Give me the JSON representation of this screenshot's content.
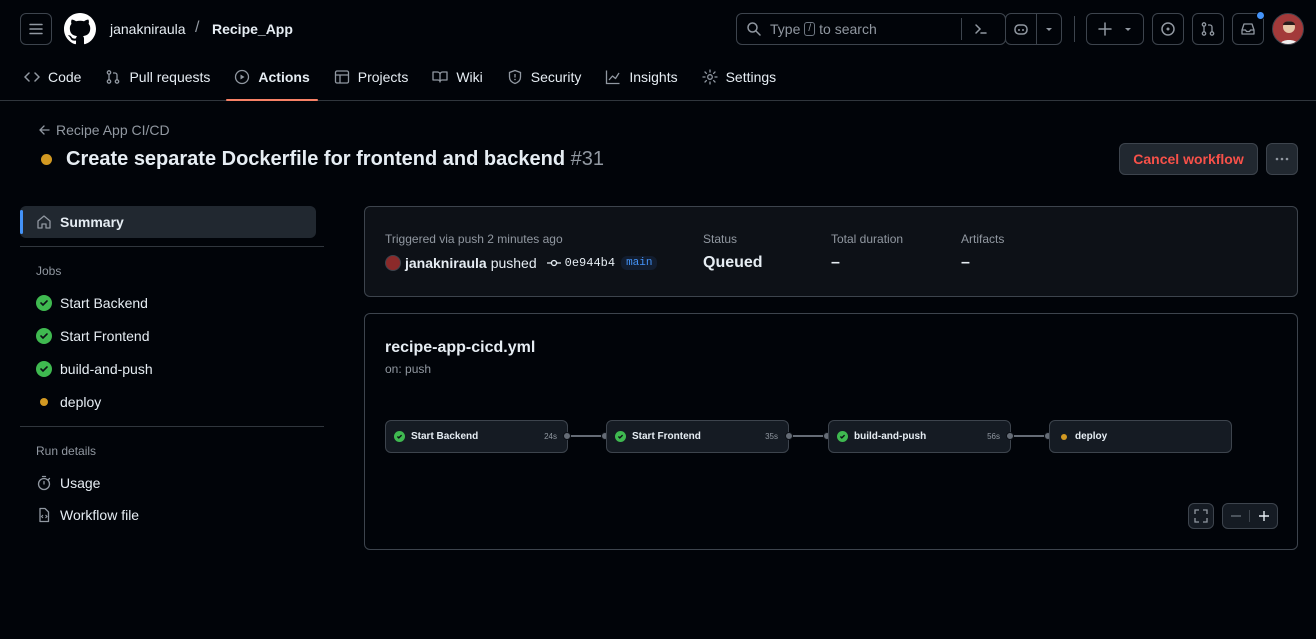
{
  "header": {
    "owner": "janakniraula",
    "slash": "/",
    "repo": "Recipe_App",
    "search_type": "Type",
    "search_key": "/",
    "search_rest": "to search"
  },
  "tabs": [
    {
      "label": "Code",
      "icon": "code-icon"
    },
    {
      "label": "Pull requests",
      "icon": "pull-request-icon"
    },
    {
      "label": "Actions",
      "icon": "play-icon"
    },
    {
      "label": "Projects",
      "icon": "table-icon"
    },
    {
      "label": "Wiki",
      "icon": "book-icon"
    },
    {
      "label": "Security",
      "icon": "shield-icon"
    },
    {
      "label": "Insights",
      "icon": "graph-icon"
    },
    {
      "label": "Settings",
      "icon": "gear-icon"
    }
  ],
  "run": {
    "back_label": "Recipe App CI/CD",
    "title": "Create separate Dockerfile for frontend and backend",
    "number": "#31",
    "cancel_label": "Cancel workflow"
  },
  "sidebar": {
    "summary": "Summary",
    "jobs_heading": "Jobs",
    "jobs": [
      {
        "label": "Start Backend",
        "status": "success"
      },
      {
        "label": "Start Frontend",
        "status": "success"
      },
      {
        "label": "build-and-push",
        "status": "success"
      },
      {
        "label": "deploy",
        "status": "queued"
      }
    ],
    "details_heading": "Run details",
    "usage": "Usage",
    "workflow_file": "Workflow file"
  },
  "summary": {
    "trigger_label": "Triggered via push 2 minutes ago",
    "user": "janakniraula",
    "action": "pushed",
    "sha": "0e944b4",
    "branch": "main",
    "status_label": "Status",
    "status_value": "Queued",
    "duration_label": "Total duration",
    "duration_value": "–",
    "artifacts_label": "Artifacts",
    "artifacts_value": "–"
  },
  "workflow": {
    "file": "recipe-app-cicd.yml",
    "trigger": "on: push",
    "jobs": [
      {
        "label": "Start Backend",
        "duration": "24s",
        "status": "success"
      },
      {
        "label": "Start Frontend",
        "duration": "35s",
        "status": "success"
      },
      {
        "label": "build-and-push",
        "duration": "56s",
        "status": "success"
      },
      {
        "label": "deploy",
        "duration": "",
        "status": "queued"
      }
    ]
  },
  "colors": {
    "accent": "#4493f8",
    "success": "#3fb950",
    "queued": "#d29922",
    "danger": "#f85149",
    "tab_underline": "#f78166"
  }
}
